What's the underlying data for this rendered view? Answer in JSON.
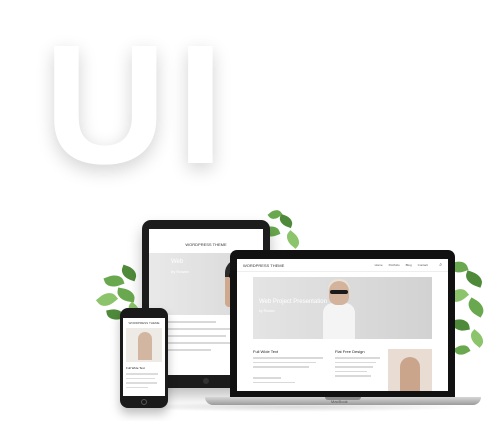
{
  "hero": {
    "text": "UI"
  },
  "tablet": {
    "brand": "WORDPRESS THEME",
    "hero_title": "Web",
    "hero_sub": "by Rowan"
  },
  "laptop": {
    "brand": "WORDPRESS THEME",
    "menu": [
      "Home",
      "Portfolio",
      "Blog",
      "Contact"
    ],
    "hero_title": "Web Project Presentation",
    "hero_sub": "by Rowan",
    "col1_title": "Full Wide Text",
    "col2_title": "Flat Free Design",
    "label": "MacBook"
  },
  "phone": {
    "brand": "WORDPRESS THEME",
    "title": "Full Wide Text"
  }
}
